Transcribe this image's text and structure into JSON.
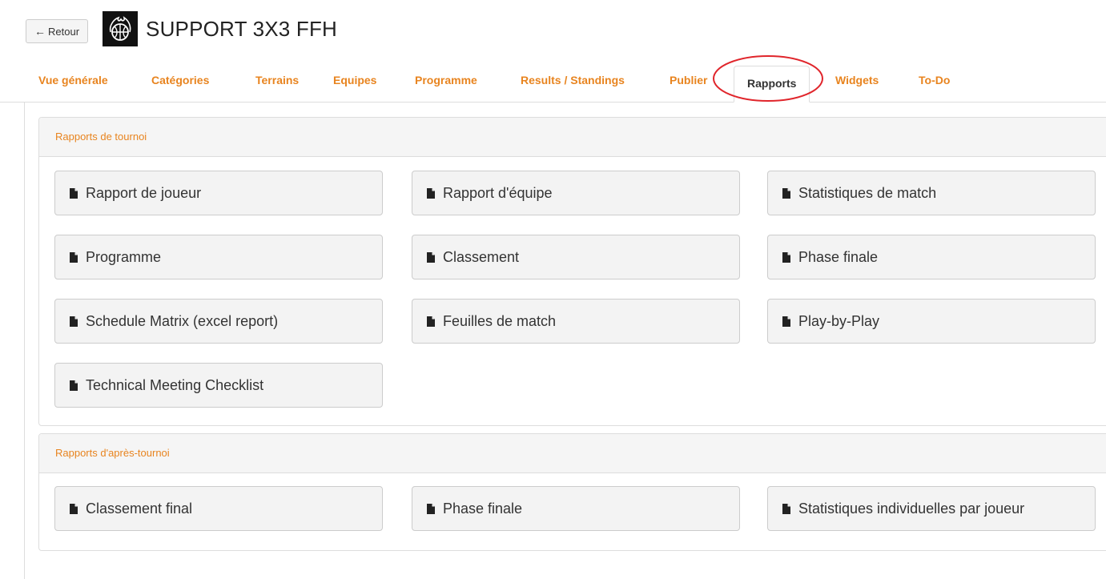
{
  "header": {
    "back_label": "Retour",
    "title": "SUPPORT 3X3 FFH"
  },
  "tabs": [
    {
      "label": "Vue générale",
      "active": false
    },
    {
      "label": "Catégories",
      "active": false
    },
    {
      "label": "Terrains",
      "active": false
    },
    {
      "label": "Equipes",
      "active": false
    },
    {
      "label": "Programme",
      "active": false
    },
    {
      "label": "Results / Standings",
      "active": false
    },
    {
      "label": "Publier",
      "active": false
    },
    {
      "label": "Rapports",
      "active": true
    },
    {
      "label": "Widgets",
      "active": false
    },
    {
      "label": "To-Do",
      "active": false
    }
  ],
  "panels": {
    "tournament": {
      "heading": "Rapports de tournoi",
      "reports": [
        "Rapport de joueur",
        "Rapport d'équipe",
        "Statistiques de match",
        "Programme",
        "Classement",
        "Phase finale",
        "Schedule Matrix (excel report)",
        "Feuilles de match",
        "Play-by-Play",
        "Technical Meeting Checklist"
      ]
    },
    "post_tournament": {
      "heading": "Rapports d'après-tournoi",
      "reports": [
        "Classement final",
        "Phase finale",
        "Statistiques individuelles par joueur"
      ]
    }
  },
  "colors": {
    "accent": "#e8841f",
    "highlight_ring": "#e0252b",
    "button_bg": "#f3f3f3",
    "border": "#dddddd"
  },
  "icons": {
    "back": "arrow-left-icon",
    "report": "file-icon",
    "logo": "basketball-flame-icon"
  }
}
